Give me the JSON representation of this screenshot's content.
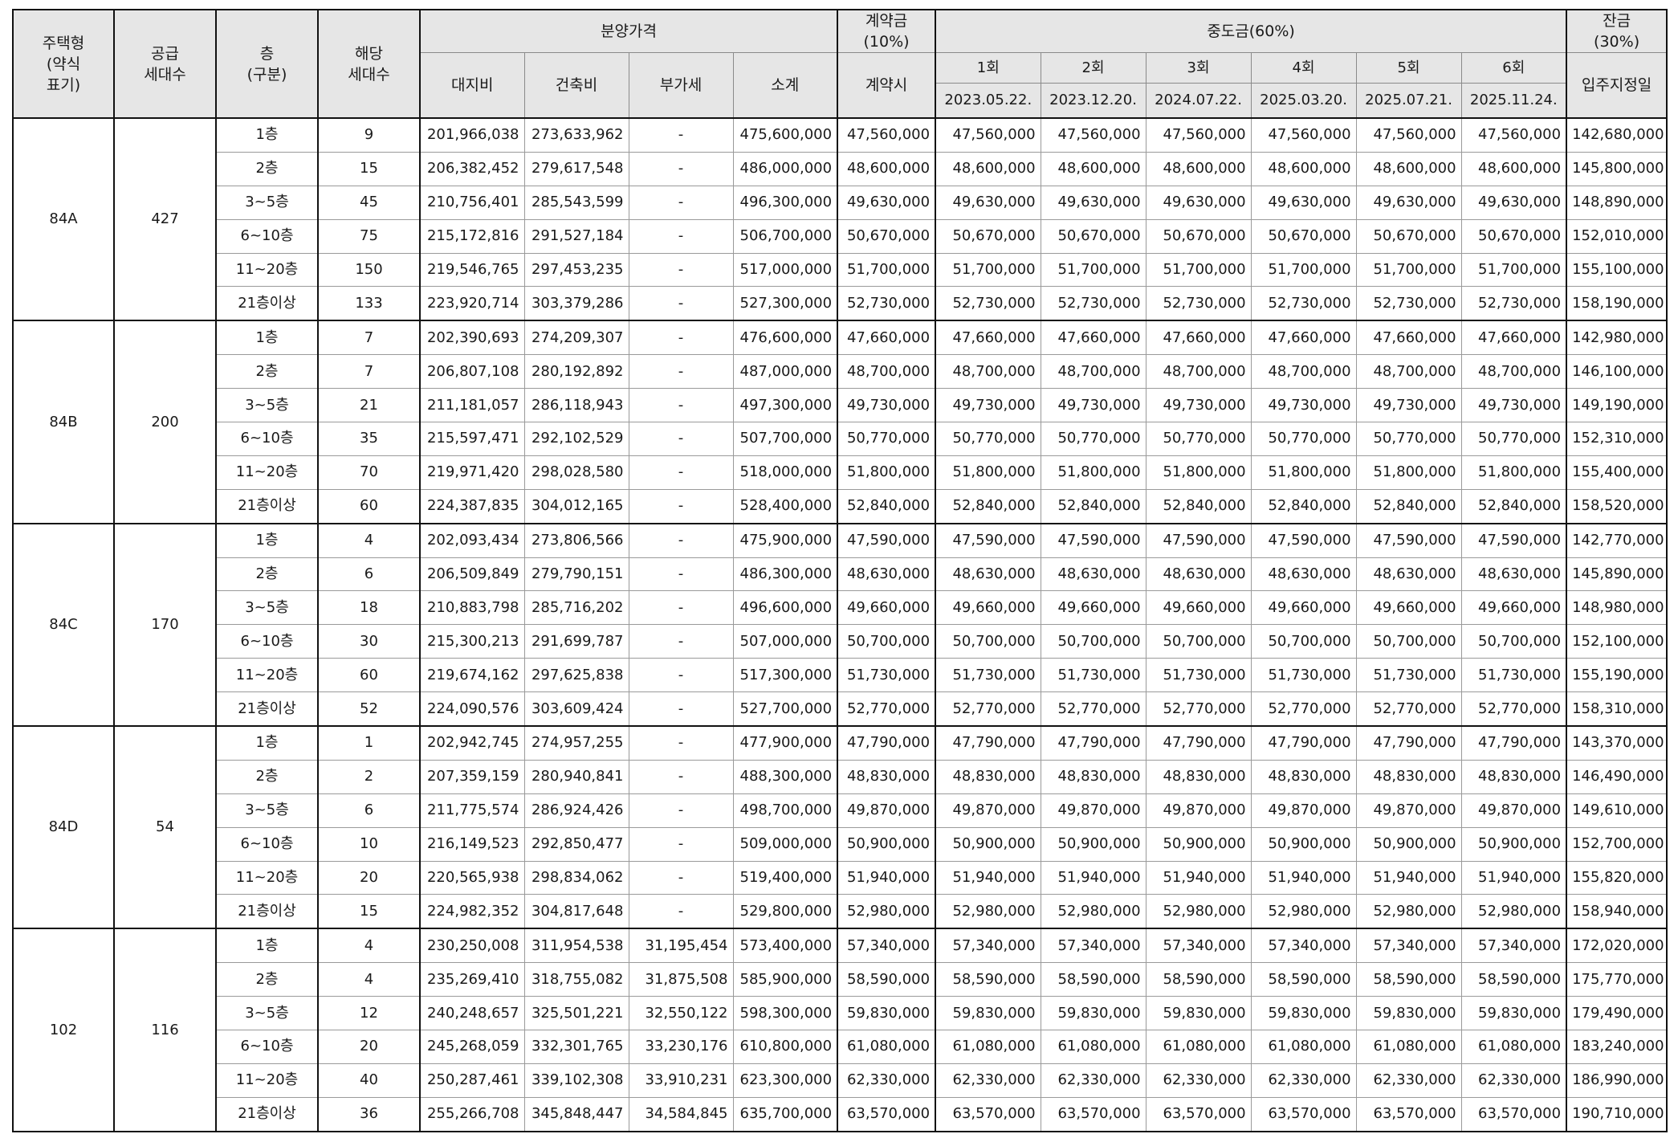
{
  "headers": {
    "type": "주택형\n(약식\n표기)",
    "supply": "공급\n세대수",
    "floor": "층\n(구분)",
    "units": "해당\n세대수",
    "price": "분양가격",
    "land": "대지비",
    "building": "건축비",
    "vat": "부가세",
    "subtotal": "소계",
    "contract": "계약금\n(10%)",
    "contract_when": "계약시",
    "interim": "중도금(60%)",
    "interim_rounds": [
      "1회",
      "2회",
      "3회",
      "4회",
      "5회",
      "6회"
    ],
    "interim_dates": [
      "2023.05.22.",
      "2023.12.20.",
      "2024.07.22.",
      "2025.03.20.",
      "2025.07.21.",
      "2025.11.24."
    ],
    "balance": "잔금\n(30%)",
    "balance_when": "입주지정일"
  },
  "groups": [
    {
      "type": "84A",
      "supply": "427",
      "rows": [
        {
          "floor": "1층",
          "units": "9",
          "land": "201,966,038",
          "building": "273,633,962",
          "vat": "-",
          "subtotal": "475,600,000",
          "contract": "47,560,000",
          "interim": [
            "47,560,000",
            "47,560,000",
            "47,560,000",
            "47,560,000",
            "47,560,000",
            "47,560,000"
          ],
          "balance": "142,680,000"
        },
        {
          "floor": "2층",
          "units": "15",
          "land": "206,382,452",
          "building": "279,617,548",
          "vat": "-",
          "subtotal": "486,000,000",
          "contract": "48,600,000",
          "interim": [
            "48,600,000",
            "48,600,000",
            "48,600,000",
            "48,600,000",
            "48,600,000",
            "48,600,000"
          ],
          "balance": "145,800,000"
        },
        {
          "floor": "3~5층",
          "units": "45",
          "land": "210,756,401",
          "building": "285,543,599",
          "vat": "-",
          "subtotal": "496,300,000",
          "contract": "49,630,000",
          "interim": [
            "49,630,000",
            "49,630,000",
            "49,630,000",
            "49,630,000",
            "49,630,000",
            "49,630,000"
          ],
          "balance": "148,890,000"
        },
        {
          "floor": "6~10층",
          "units": "75",
          "land": "215,172,816",
          "building": "291,527,184",
          "vat": "-",
          "subtotal": "506,700,000",
          "contract": "50,670,000",
          "interim": [
            "50,670,000",
            "50,670,000",
            "50,670,000",
            "50,670,000",
            "50,670,000",
            "50,670,000"
          ],
          "balance": "152,010,000"
        },
        {
          "floor": "11~20층",
          "units": "150",
          "land": "219,546,765",
          "building": "297,453,235",
          "vat": "-",
          "subtotal": "517,000,000",
          "contract": "51,700,000",
          "interim": [
            "51,700,000",
            "51,700,000",
            "51,700,000",
            "51,700,000",
            "51,700,000",
            "51,700,000"
          ],
          "balance": "155,100,000"
        },
        {
          "floor": "21층이상",
          "units": "133",
          "land": "223,920,714",
          "building": "303,379,286",
          "vat": "-",
          "subtotal": "527,300,000",
          "contract": "52,730,000",
          "interim": [
            "52,730,000",
            "52,730,000",
            "52,730,000",
            "52,730,000",
            "52,730,000",
            "52,730,000"
          ],
          "balance": "158,190,000"
        }
      ]
    },
    {
      "type": "84B",
      "supply": "200",
      "rows": [
        {
          "floor": "1층",
          "units": "7",
          "land": "202,390,693",
          "building": "274,209,307",
          "vat": "-",
          "subtotal": "476,600,000",
          "contract": "47,660,000",
          "interim": [
            "47,660,000",
            "47,660,000",
            "47,660,000",
            "47,660,000",
            "47,660,000",
            "47,660,000"
          ],
          "balance": "142,980,000"
        },
        {
          "floor": "2층",
          "units": "7",
          "land": "206,807,108",
          "building": "280,192,892",
          "vat": "-",
          "subtotal": "487,000,000",
          "contract": "48,700,000",
          "interim": [
            "48,700,000",
            "48,700,000",
            "48,700,000",
            "48,700,000",
            "48,700,000",
            "48,700,000"
          ],
          "balance": "146,100,000"
        },
        {
          "floor": "3~5층",
          "units": "21",
          "land": "211,181,057",
          "building": "286,118,943",
          "vat": "-",
          "subtotal": "497,300,000",
          "contract": "49,730,000",
          "interim": [
            "49,730,000",
            "49,730,000",
            "49,730,000",
            "49,730,000",
            "49,730,000",
            "49,730,000"
          ],
          "balance": "149,190,000"
        },
        {
          "floor": "6~10층",
          "units": "35",
          "land": "215,597,471",
          "building": "292,102,529",
          "vat": "-",
          "subtotal": "507,700,000",
          "contract": "50,770,000",
          "interim": [
            "50,770,000",
            "50,770,000",
            "50,770,000",
            "50,770,000",
            "50,770,000",
            "50,770,000"
          ],
          "balance": "152,310,000"
        },
        {
          "floor": "11~20층",
          "units": "70",
          "land": "219,971,420",
          "building": "298,028,580",
          "vat": "-",
          "subtotal": "518,000,000",
          "contract": "51,800,000",
          "interim": [
            "51,800,000",
            "51,800,000",
            "51,800,000",
            "51,800,000",
            "51,800,000",
            "51,800,000"
          ],
          "balance": "155,400,000"
        },
        {
          "floor": "21층이상",
          "units": "60",
          "land": "224,387,835",
          "building": "304,012,165",
          "vat": "-",
          "subtotal": "528,400,000",
          "contract": "52,840,000",
          "interim": [
            "52,840,000",
            "52,840,000",
            "52,840,000",
            "52,840,000",
            "52,840,000",
            "52,840,000"
          ],
          "balance": "158,520,000"
        }
      ]
    },
    {
      "type": "84C",
      "supply": "170",
      "rows": [
        {
          "floor": "1층",
          "units": "4",
          "land": "202,093,434",
          "building": "273,806,566",
          "vat": "-",
          "subtotal": "475,900,000",
          "contract": "47,590,000",
          "interim": [
            "47,590,000",
            "47,590,000",
            "47,590,000",
            "47,590,000",
            "47,590,000",
            "47,590,000"
          ],
          "balance": "142,770,000"
        },
        {
          "floor": "2층",
          "units": "6",
          "land": "206,509,849",
          "building": "279,790,151",
          "vat": "-",
          "subtotal": "486,300,000",
          "contract": "48,630,000",
          "interim": [
            "48,630,000",
            "48,630,000",
            "48,630,000",
            "48,630,000",
            "48,630,000",
            "48,630,000"
          ],
          "balance": "145,890,000"
        },
        {
          "floor": "3~5층",
          "units": "18",
          "land": "210,883,798",
          "building": "285,716,202",
          "vat": "-",
          "subtotal": "496,600,000",
          "contract": "49,660,000",
          "interim": [
            "49,660,000",
            "49,660,000",
            "49,660,000",
            "49,660,000",
            "49,660,000",
            "49,660,000"
          ],
          "balance": "148,980,000"
        },
        {
          "floor": "6~10층",
          "units": "30",
          "land": "215,300,213",
          "building": "291,699,787",
          "vat": "-",
          "subtotal": "507,000,000",
          "contract": "50,700,000",
          "interim": [
            "50,700,000",
            "50,700,000",
            "50,700,000",
            "50,700,000",
            "50,700,000",
            "50,700,000"
          ],
          "balance": "152,100,000"
        },
        {
          "floor": "11~20층",
          "units": "60",
          "land": "219,674,162",
          "building": "297,625,838",
          "vat": "-",
          "subtotal": "517,300,000",
          "contract": "51,730,000",
          "interim": [
            "51,730,000",
            "51,730,000",
            "51,730,000",
            "51,730,000",
            "51,730,000",
            "51,730,000"
          ],
          "balance": "155,190,000"
        },
        {
          "floor": "21층이상",
          "units": "52",
          "land": "224,090,576",
          "building": "303,609,424",
          "vat": "-",
          "subtotal": "527,700,000",
          "contract": "52,770,000",
          "interim": [
            "52,770,000",
            "52,770,000",
            "52,770,000",
            "52,770,000",
            "52,770,000",
            "52,770,000"
          ],
          "balance": "158,310,000"
        }
      ]
    },
    {
      "type": "84D",
      "supply": "54",
      "rows": [
        {
          "floor": "1층",
          "units": "1",
          "land": "202,942,745",
          "building": "274,957,255",
          "vat": "-",
          "subtotal": "477,900,000",
          "contract": "47,790,000",
          "interim": [
            "47,790,000",
            "47,790,000",
            "47,790,000",
            "47,790,000",
            "47,790,000",
            "47,790,000"
          ],
          "balance": "143,370,000"
        },
        {
          "floor": "2층",
          "units": "2",
          "land": "207,359,159",
          "building": "280,940,841",
          "vat": "-",
          "subtotal": "488,300,000",
          "contract": "48,830,000",
          "interim": [
            "48,830,000",
            "48,830,000",
            "48,830,000",
            "48,830,000",
            "48,830,000",
            "48,830,000"
          ],
          "balance": "146,490,000"
        },
        {
          "floor": "3~5층",
          "units": "6",
          "land": "211,775,574",
          "building": "286,924,426",
          "vat": "-",
          "subtotal": "498,700,000",
          "contract": "49,870,000",
          "interim": [
            "49,870,000",
            "49,870,000",
            "49,870,000",
            "49,870,000",
            "49,870,000",
            "49,870,000"
          ],
          "balance": "149,610,000"
        },
        {
          "floor": "6~10층",
          "units": "10",
          "land": "216,149,523",
          "building": "292,850,477",
          "vat": "-",
          "subtotal": "509,000,000",
          "contract": "50,900,000",
          "interim": [
            "50,900,000",
            "50,900,000",
            "50,900,000",
            "50,900,000",
            "50,900,000",
            "50,900,000"
          ],
          "balance": "152,700,000"
        },
        {
          "floor": "11~20층",
          "units": "20",
          "land": "220,565,938",
          "building": "298,834,062",
          "vat": "-",
          "subtotal": "519,400,000",
          "contract": "51,940,000",
          "interim": [
            "51,940,000",
            "51,940,000",
            "51,940,000",
            "51,940,000",
            "51,940,000",
            "51,940,000"
          ],
          "balance": "155,820,000"
        },
        {
          "floor": "21층이상",
          "units": "15",
          "land": "224,982,352",
          "building": "304,817,648",
          "vat": "-",
          "subtotal": "529,800,000",
          "contract": "52,980,000",
          "interim": [
            "52,980,000",
            "52,980,000",
            "52,980,000",
            "52,980,000",
            "52,980,000",
            "52,980,000"
          ],
          "balance": "158,940,000"
        }
      ]
    },
    {
      "type": "102",
      "supply": "116",
      "rows": [
        {
          "floor": "1층",
          "units": "4",
          "land": "230,250,008",
          "building": "311,954,538",
          "vat": "31,195,454",
          "subtotal": "573,400,000",
          "contract": "57,340,000",
          "interim": [
            "57,340,000",
            "57,340,000",
            "57,340,000",
            "57,340,000",
            "57,340,000",
            "57,340,000"
          ],
          "balance": "172,020,000"
        },
        {
          "floor": "2층",
          "units": "4",
          "land": "235,269,410",
          "building": "318,755,082",
          "vat": "31,875,508",
          "subtotal": "585,900,000",
          "contract": "58,590,000",
          "interim": [
            "58,590,000",
            "58,590,000",
            "58,590,000",
            "58,590,000",
            "58,590,000",
            "58,590,000"
          ],
          "balance": "175,770,000"
        },
        {
          "floor": "3~5층",
          "units": "12",
          "land": "240,248,657",
          "building": "325,501,221",
          "vat": "32,550,122",
          "subtotal": "598,300,000",
          "contract": "59,830,000",
          "interim": [
            "59,830,000",
            "59,830,000",
            "59,830,000",
            "59,830,000",
            "59,830,000",
            "59,830,000"
          ],
          "balance": "179,490,000"
        },
        {
          "floor": "6~10층",
          "units": "20",
          "land": "245,268,059",
          "building": "332,301,765",
          "vat": "33,230,176",
          "subtotal": "610,800,000",
          "contract": "61,080,000",
          "interim": [
            "61,080,000",
            "61,080,000",
            "61,080,000",
            "61,080,000",
            "61,080,000",
            "61,080,000"
          ],
          "balance": "183,240,000"
        },
        {
          "floor": "11~20층",
          "units": "40",
          "land": "250,287,461",
          "building": "339,102,308",
          "vat": "33,910,231",
          "subtotal": "623,300,000",
          "contract": "62,330,000",
          "interim": [
            "62,330,000",
            "62,330,000",
            "62,330,000",
            "62,330,000",
            "62,330,000",
            "62,330,000"
          ],
          "balance": "186,990,000"
        },
        {
          "floor": "21층이상",
          "units": "36",
          "land": "255,266,708",
          "building": "345,848,447",
          "vat": "34,584,845",
          "subtotal": "635,700,000",
          "contract": "63,570,000",
          "interim": [
            "63,570,000",
            "63,570,000",
            "63,570,000",
            "63,570,000",
            "63,570,000",
            "63,570,000"
          ],
          "balance": "190,710,000"
        }
      ]
    }
  ]
}
